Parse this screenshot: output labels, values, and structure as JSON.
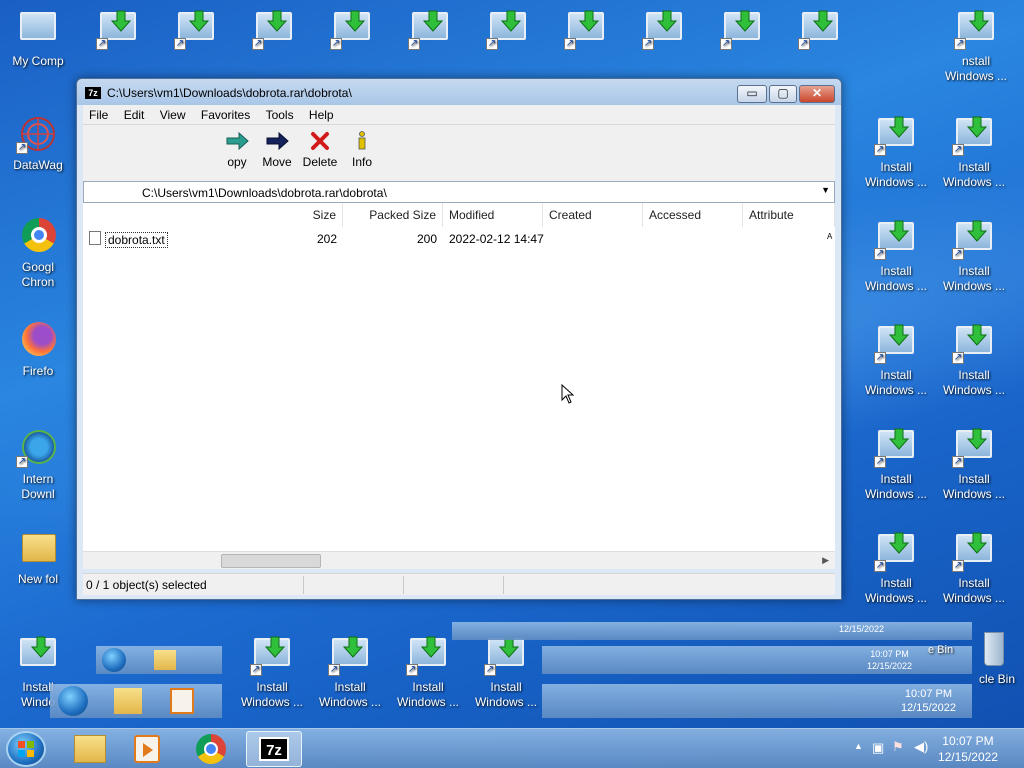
{
  "desktop": {
    "left_icons": [
      {
        "label": "My Comp",
        "icon": "computer-icon"
      },
      {
        "label": "DataWag",
        "icon": "datawag-icon"
      },
      {
        "label": "Googl Chron",
        "icon": "chrome-icon"
      },
      {
        "label": "Firefo",
        "icon": "firefox-icon"
      },
      {
        "label": "Intern Downl",
        "icon": "download-manager-icon"
      },
      {
        "label": "New fol",
        "icon": "folder-icon"
      },
      {
        "label": "Install Windo",
        "icon": "install-windows-icon"
      }
    ],
    "install_label_line1": "Install",
    "install_label_line2": "Windows ...",
    "partial_top_label_line1": "nstall",
    "partial_top_label_line2": "Windows ...",
    "recycle_label": "cle Bin",
    "ghost_recycle_label": "e Bin"
  },
  "window": {
    "title": "C:\\Users\\vm1\\Downloads\\dobrota.rar\\dobrota\\",
    "app_icon_text": "7z",
    "minimize_label": "▭",
    "maximize_label": "▢",
    "close_label": "✕",
    "menu": [
      "File",
      "Edit",
      "View",
      "Favorites",
      "Tools",
      "Help"
    ],
    "toolbar": [
      {
        "label": "opy",
        "icon": "copy-icon"
      },
      {
        "label": "Move",
        "icon": "move-icon"
      },
      {
        "label": "Delete",
        "icon": "delete-icon"
      },
      {
        "label": "Info",
        "icon": "info-icon"
      }
    ],
    "address": "C:\\Users\\vm1\\Downloads\\dobrota.rar\\dobrota\\",
    "columns": [
      "Size",
      "Packed Size",
      "Modified",
      "Created",
      "Accessed",
      "Attribute"
    ],
    "rows": [
      {
        "name": "dobrota.txt",
        "size": "202",
        "packed_size": "200",
        "modified": "2022-02-12 14:47",
        "created": "",
        "accessed": "",
        "attributes": "A"
      }
    ],
    "status": "0 / 1 object(s) selected"
  },
  "taskbar": {
    "time": "10:07 PM",
    "date": "12/15/2022",
    "apps": [
      "file-explorer-icon",
      "media-player-icon",
      "chrome-icon",
      "7zip-icon"
    ],
    "active_app_label": "7z"
  },
  "colors": {
    "accent": "#1a5fc4",
    "window_frame": "#a9c6e8",
    "close_red": "#c9462c"
  }
}
